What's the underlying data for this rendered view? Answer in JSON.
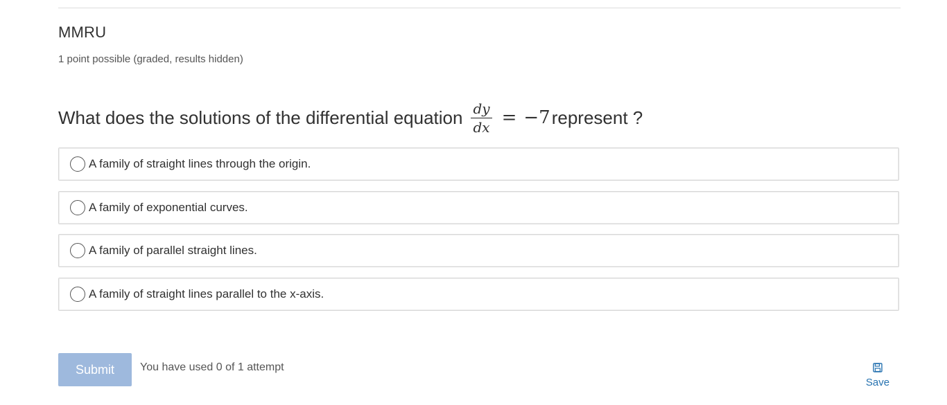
{
  "problem": {
    "title": "MMRU",
    "grading_info": "1 point possible (graded, results hidden)"
  },
  "question": {
    "prefix": "What does the solutions of the differential equation",
    "math_numerator": "dy",
    "math_denominator": "dx",
    "math_equals": "=",
    "math_rhs": "−7",
    "suffix": "represent ?"
  },
  "choices": [
    {
      "label": "A family of straight lines through the origin.",
      "selected": false
    },
    {
      "label": "A family of exponential curves.",
      "selected": false
    },
    {
      "label": "A family of parallel straight lines.",
      "selected": false
    },
    {
      "label": "A family of straight lines parallel to the x-axis.",
      "selected": false
    }
  ],
  "actions": {
    "submit_label": "Submit",
    "attempts_text": "You have used 0 of 1 attempt",
    "save_label": "Save",
    "save_icon": "floppy-disk-icon"
  },
  "colors": {
    "submit_bg": "#9eb9dd",
    "link": "#2672b0",
    "border": "#d7d7d7"
  }
}
